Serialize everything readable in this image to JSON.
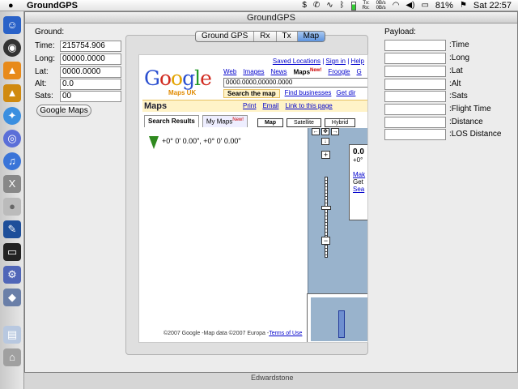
{
  "menubar": {
    "app_name": "GroundGPS",
    "net_tx": "Tx:",
    "net_rx": "Rx:",
    "net_rate1": "0B/s",
    "net_rate2": "0B/s",
    "battery": "81%",
    "clock": "Sat 22:57"
  },
  "window": {
    "title": "GroundGPS"
  },
  "ground": {
    "title": "Ground:",
    "fields": [
      {
        "label": "Time:",
        "value": "215754.906"
      },
      {
        "label": "Long:",
        "value": "00000.0000"
      },
      {
        "label": "Lat:",
        "value": "0000.0000"
      },
      {
        "label": "Alt:",
        "value": "0.0"
      },
      {
        "label": "Sats:",
        "value": "00"
      }
    ],
    "button": "Google Maps"
  },
  "tabs": [
    "Ground GPS",
    "Rx",
    "Tx",
    "Map"
  ],
  "active_tab": "Map",
  "payload": {
    "title": "Payload:",
    "fields": [
      {
        "label": ":Time",
        "value": ""
      },
      {
        "label": ":Long",
        "value": ""
      },
      {
        "label": ":Lat",
        "value": ""
      },
      {
        "label": ":Alt",
        "value": ""
      },
      {
        "label": ":Sats",
        "value": ""
      },
      {
        "label": ":Flight Time",
        "value": ""
      },
      {
        "label": ":Distance",
        "value": ""
      },
      {
        "label": ":LOS Distance",
        "value": ""
      }
    ]
  },
  "web": {
    "top_links": [
      "Saved Locations",
      "Sign in",
      "Help"
    ],
    "logo_sub": "Maps UK",
    "nav": [
      "Web",
      "Images",
      "News",
      "Maps",
      "Froogle",
      "G"
    ],
    "nav_new": "New!",
    "search_value": "0000.0000,00000.0000",
    "search_tabs": [
      "Search the map",
      "Find businesses",
      "Get dir"
    ],
    "maps_heading": "Maps",
    "maps_links": [
      "Print",
      "Email",
      "Link to this page"
    ],
    "result_tabs": [
      "Search Results",
      "My Maps"
    ],
    "result_new": "New!",
    "map_types": [
      "Map",
      "Satellite",
      "Hybrid"
    ],
    "coords": "+0° 0' 0.00\", +0° 0' 0.00\"",
    "info_big": "0.0",
    "info_small": "+0°",
    "info_link1": "Mak",
    "info_text": "Get",
    "info_link2": "Sea",
    "footer_text": "©2007 Google -Map data ©2007 Europa -",
    "footer_link": "Terms of Use"
  },
  "bgstrip": {
    "text1": "Edwardstone"
  }
}
